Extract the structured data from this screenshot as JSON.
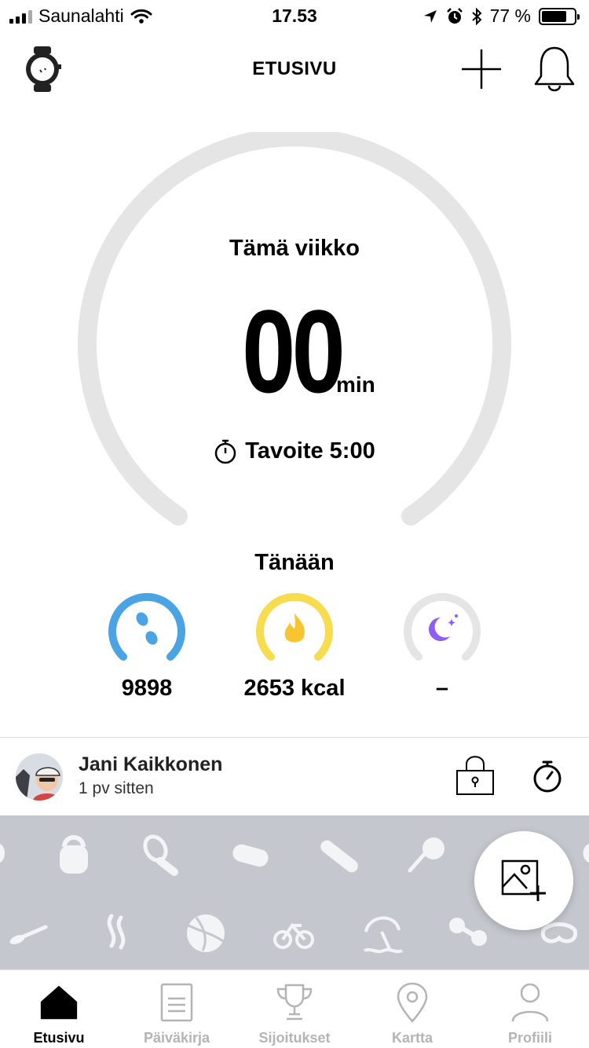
{
  "status_bar": {
    "carrier": "Saunalahti",
    "time": "17.53",
    "battery_percent": "77 %",
    "battery_level": 0.77
  },
  "header": {
    "title": "ETUSIVU"
  },
  "weekly": {
    "label": "Tämä viikko",
    "value": "00",
    "unit": "min",
    "goal": "Tavoite 5:00",
    "progress": 0
  },
  "today": {
    "label": "Tänään",
    "metrics": [
      {
        "value": "9898",
        "icon": "steps-icon",
        "color": "#4aa3e2"
      },
      {
        "value": "2653 kcal",
        "icon": "flame-icon",
        "color": "#f7dc4f"
      },
      {
        "value": "–",
        "icon": "moon-icon",
        "color": "#8f5cf7"
      }
    ]
  },
  "feed": {
    "user_name": "Jani Kaikkonen",
    "time_ago": "1 pv sitten"
  },
  "tabs": [
    {
      "label": "Etusivu",
      "active": true
    },
    {
      "label": "Päiväkirja"
    },
    {
      "label": "Sijoitukset"
    },
    {
      "label": "Kartta"
    },
    {
      "label": "Profiili"
    }
  ],
  "colors": {
    "ring_track": "#e5e5e5",
    "tile_background": "#c4c7cd",
    "inactive_tab": "#b4b4b4"
  }
}
